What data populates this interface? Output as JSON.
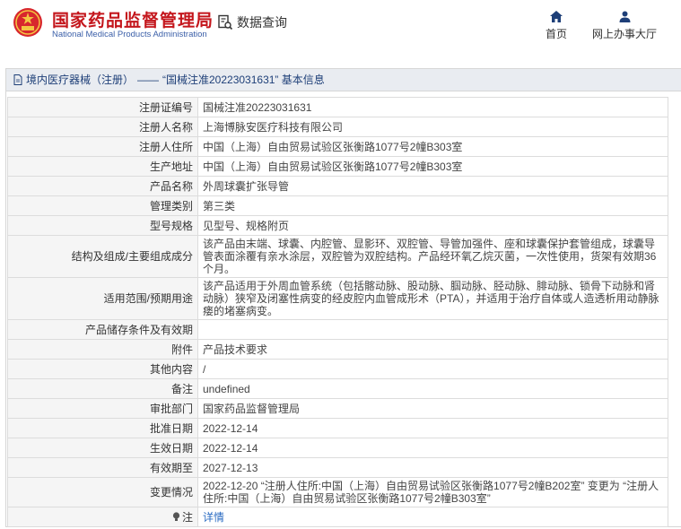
{
  "header": {
    "site_name_cn": "国家药品监督管理局",
    "site_name_en": "National Medical Products Administration",
    "query_label": "数据查询",
    "nav": [
      {
        "label": "首页",
        "icon": "home-icon"
      },
      {
        "label": "网上办事大厅",
        "icon": "user-icon"
      }
    ]
  },
  "breadcrumb": {
    "section": "境内医疗器械（注册）",
    "separator": "——",
    "suffix": "“国械注准20223031631” 基本信息"
  },
  "rows": [
    {
      "key": "注册证编号",
      "value": "国械注准20223031631"
    },
    {
      "key": "注册人名称",
      "value": "上海博脉安医疗科技有限公司"
    },
    {
      "key": "注册人住所",
      "value": "中国（上海）自由贸易试验区张衡路1077号2幢B303室"
    },
    {
      "key": "生产地址",
      "value": "中国（上海）自由贸易试验区张衡路1077号2幢B303室"
    },
    {
      "key": "产品名称",
      "value": "外周球囊扩张导管"
    },
    {
      "key": "管理类别",
      "value": "第三类"
    },
    {
      "key": "型号规格",
      "value": "见型号、规格附页"
    },
    {
      "key": "结构及组成/主要组成成分",
      "value": "该产品由末端、球囊、内腔管、显影环、双腔管、导管加强件、座和球囊保护套管组成，球囊导管表面涂覆有亲水涂层，双腔管为双腔结构。产品经环氧乙烷灭菌，一次性使用，货架有效期36个月。"
    },
    {
      "key": "适用范围/预期用途",
      "value": "该产品适用于外周血管系统（包括髂动脉、股动脉、腘动脉、胫动脉、腓动脉、锁骨下动脉和肾动脉）狭窄及闭塞性病变的经皮腔内血管成形术（PTA），并适用于治疗自体或人造透析用动静脉瘘的堵塞病变。"
    },
    {
      "key": "产品储存条件及有效期",
      "value": ""
    },
    {
      "key": "附件",
      "value": "产品技术要求"
    },
    {
      "key": "其他内容",
      "value": "/"
    },
    {
      "key": "备注",
      "value": "undefined"
    },
    {
      "key": "审批部门",
      "value": "国家药品监督管理局"
    },
    {
      "key": "批准日期",
      "value": "2022-12-14"
    },
    {
      "key": "生效日期",
      "value": "2022-12-14"
    },
    {
      "key": "有效期至",
      "value": "2027-12-13"
    },
    {
      "key": "变更情况",
      "value": "2022-12-20 “注册人住所:中国（上海）自由贸易试验区张衡路1077号2幢B202室” 变更为 “注册人住所:中国（上海）自由贸易试验区张衡路1077号2幢B303室”"
    }
  ],
  "note_row": {
    "key": "注",
    "link": "详情"
  },
  "colors": {
    "brand_red": "#c4161c",
    "link_blue": "#2a6bc2",
    "crumb_bg": "#e9ecf1"
  }
}
